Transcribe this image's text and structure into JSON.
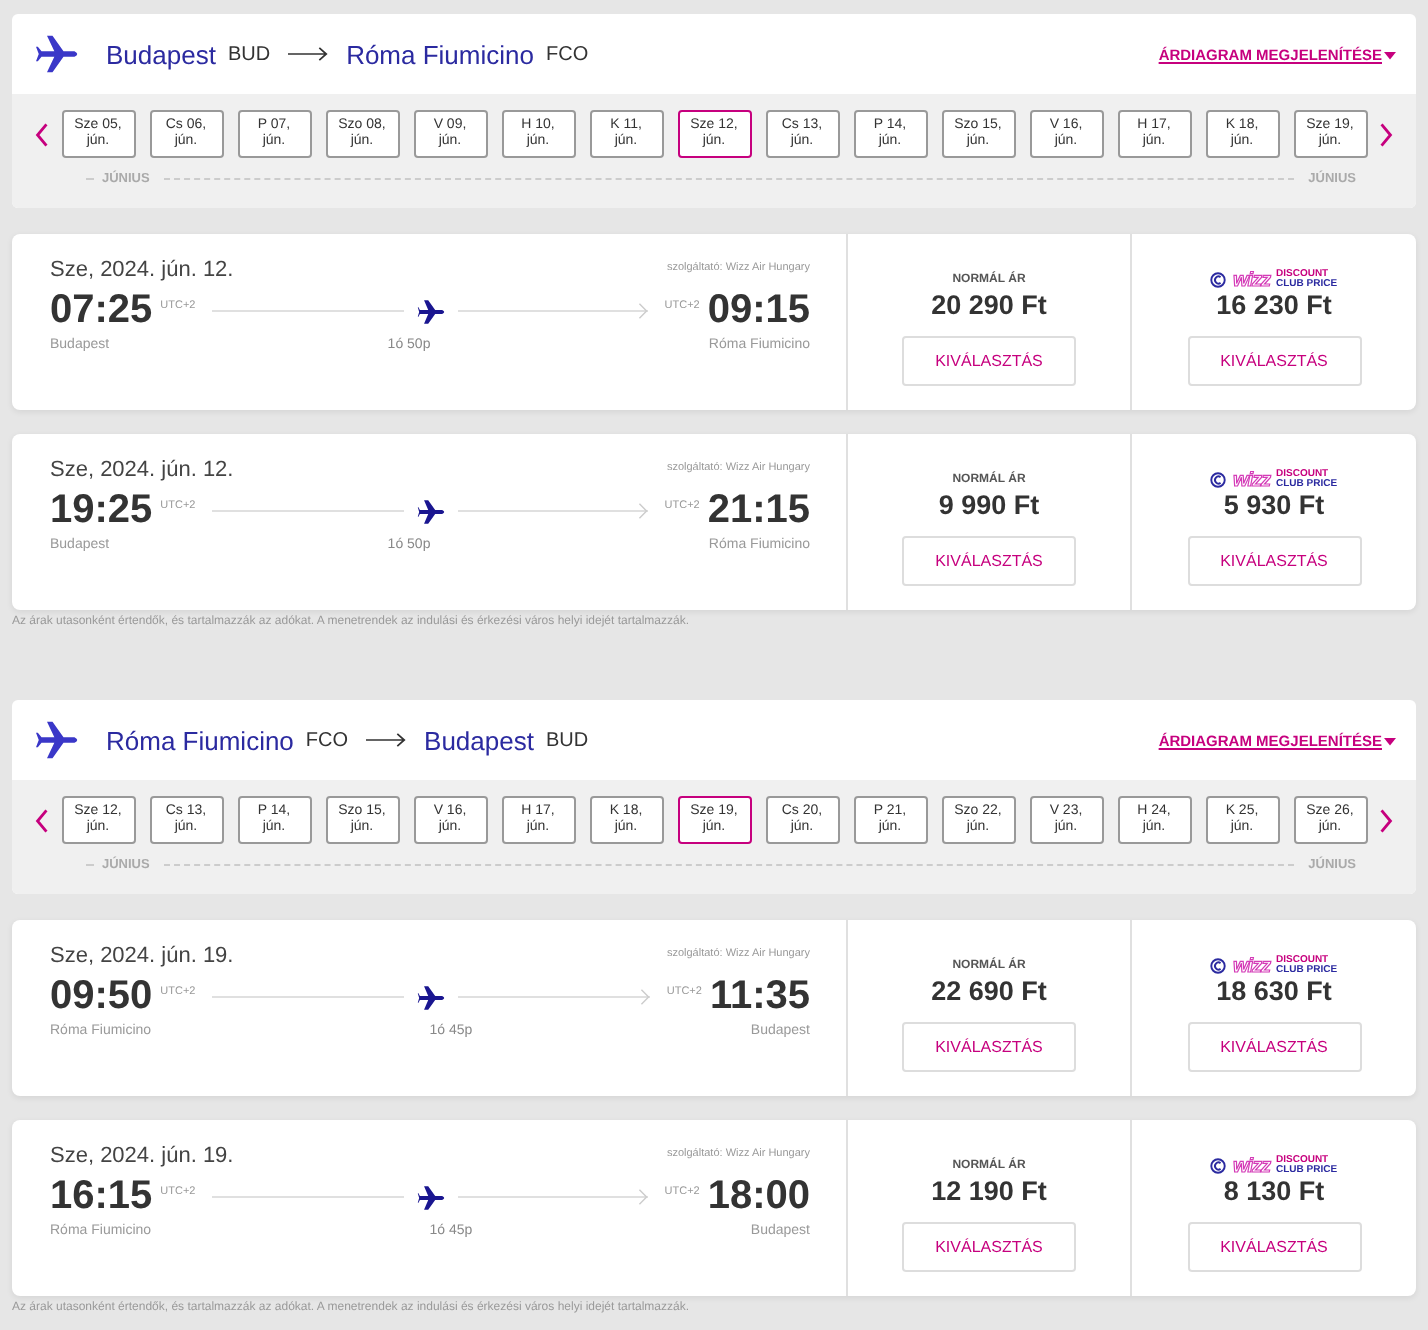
{
  "sections": [
    {
      "route": {
        "from_city": "Budapest",
        "from_code": "BUD",
        "to_city": "Róma Fiumicino",
        "to_code": "FCO"
      },
      "price_chart_link": "ÁRDIAGRAM MEGJELENÍTÉSE",
      "dates": [
        {
          "day": "Sze 05,",
          "month": "jún.",
          "selected": false
        },
        {
          "day": "Cs 06,",
          "month": "jún.",
          "selected": false
        },
        {
          "day": "P 07,",
          "month": "jún.",
          "selected": false
        },
        {
          "day": "Szo 08,",
          "month": "jún.",
          "selected": false
        },
        {
          "day": "V 09,",
          "month": "jún.",
          "selected": false
        },
        {
          "day": "H 10,",
          "month": "jún.",
          "selected": false
        },
        {
          "day": "K 11,",
          "month": "jún.",
          "selected": false
        },
        {
          "day": "Sze 12,",
          "month": "jún.",
          "selected": true
        },
        {
          "day": "Cs 13,",
          "month": "jún.",
          "selected": false
        },
        {
          "day": "P 14,",
          "month": "jún.",
          "selected": false
        },
        {
          "day": "Szo 15,",
          "month": "jún.",
          "selected": false
        },
        {
          "day": "V 16,",
          "month": "jún.",
          "selected": false
        },
        {
          "day": "H 17,",
          "month": "jún.",
          "selected": false
        },
        {
          "day": "K 18,",
          "month": "jún.",
          "selected": false
        },
        {
          "day": "Sze 19,",
          "month": "jún.",
          "selected": false
        }
      ],
      "month_labels": [
        "JÚNIUS",
        "JÚNIUS"
      ],
      "flights": [
        {
          "date": "Sze, 2024. jún. 12.",
          "operator": "szolgáltató: Wizz Air Hungary",
          "departure_time": "07:25",
          "departure_tz": "UTC+2",
          "arrival_tz": "UTC+2",
          "arrival_time": "09:15",
          "origin": "Budapest",
          "duration": "1ó 50p",
          "destination": "Róma Fiumicino",
          "normal_label": "NORMÁL ÁR",
          "normal_price": "20 290 Ft",
          "normal_button": "KIVÁLASZTÁS",
          "club_badge": {
            "brand": "wizz",
            "line1": "DISCOUNT",
            "line2": "CLUB PRICE"
          },
          "club_price": "16 230 Ft",
          "club_button": "KIVÁLASZTÁS"
        },
        {
          "date": "Sze, 2024. jún. 12.",
          "operator": "szolgáltató: Wizz Air Hungary",
          "departure_time": "19:25",
          "departure_tz": "UTC+2",
          "arrival_tz": "UTC+2",
          "arrival_time": "21:15",
          "origin": "Budapest",
          "duration": "1ó 50p",
          "destination": "Róma Fiumicino",
          "normal_label": "NORMÁL ÁR",
          "normal_price": "9 990 Ft",
          "normal_button": "KIVÁLASZTÁS",
          "club_badge": {
            "brand": "wizz",
            "line1": "DISCOUNT",
            "line2": "CLUB PRICE"
          },
          "club_price": "5 930 Ft",
          "club_button": "KIVÁLASZTÁS"
        }
      ],
      "footnote": "Az árak utasonként értendők, és tartalmazzák az adókat. A menetrendek az indulási és érkezési város helyi idejét tartalmazzák."
    },
    {
      "route": {
        "from_city": "Róma Fiumicino",
        "from_code": "FCO",
        "to_city": "Budapest",
        "to_code": "BUD"
      },
      "price_chart_link": "ÁRDIAGRAM MEGJELENÍTÉSE",
      "dates": [
        {
          "day": "Sze 12,",
          "month": "jún.",
          "selected": false
        },
        {
          "day": "Cs 13,",
          "month": "jún.",
          "selected": false
        },
        {
          "day": "P 14,",
          "month": "jún.",
          "selected": false
        },
        {
          "day": "Szo 15,",
          "month": "jún.",
          "selected": false
        },
        {
          "day": "V 16,",
          "month": "jún.",
          "selected": false
        },
        {
          "day": "H 17,",
          "month": "jún.",
          "selected": false
        },
        {
          "day": "K 18,",
          "month": "jún.",
          "selected": false
        },
        {
          "day": "Sze 19,",
          "month": "jún.",
          "selected": true
        },
        {
          "day": "Cs 20,",
          "month": "jún.",
          "selected": false
        },
        {
          "day": "P 21,",
          "month": "jún.",
          "selected": false
        },
        {
          "day": "Szo 22,",
          "month": "jún.",
          "selected": false
        },
        {
          "day": "V 23,",
          "month": "jún.",
          "selected": false
        },
        {
          "day": "H 24,",
          "month": "jún.",
          "selected": false
        },
        {
          "day": "K 25,",
          "month": "jún.",
          "selected": false
        },
        {
          "day": "Sze 26,",
          "month": "jún.",
          "selected": false
        }
      ],
      "month_labels": [
        "JÚNIUS",
        "JÚNIUS"
      ],
      "flights": [
        {
          "date": "Sze, 2024. jún. 19.",
          "operator": "szolgáltató: Wizz Air Hungary",
          "departure_time": "09:50",
          "departure_tz": "UTC+2",
          "arrival_tz": "UTC+2",
          "arrival_time": "11:35",
          "origin": "Róma Fiumicino",
          "duration": "1ó 45p",
          "destination": "Budapest",
          "normal_label": "NORMÁL ÁR",
          "normal_price": "22 690 Ft",
          "normal_button": "KIVÁLASZTÁS",
          "club_badge": {
            "brand": "wizz",
            "line1": "DISCOUNT",
            "line2": "CLUB PRICE"
          },
          "club_price": "18 630 Ft",
          "club_button": "KIVÁLASZTÁS"
        },
        {
          "date": "Sze, 2024. jún. 19.",
          "operator": "szolgáltató: Wizz Air Hungary",
          "departure_time": "16:15",
          "departure_tz": "UTC+2",
          "arrival_tz": "UTC+2",
          "arrival_time": "18:00",
          "origin": "Róma Fiumicino",
          "duration": "1ó 45p",
          "destination": "Budapest",
          "normal_label": "NORMÁL ÁR",
          "normal_price": "12 190 Ft",
          "normal_button": "KIVÁLASZTÁS",
          "club_badge": {
            "brand": "wizz",
            "line1": "DISCOUNT",
            "line2": "CLUB PRICE"
          },
          "club_price": "8 130 Ft",
          "club_button": "KIVÁLASZTÁS"
        }
      ],
      "footnote": "Az árak utasonként értendők, és tartalmazzák az adókat. A menetrendek az indulási és érkezési város helyi idejét tartalmazzák."
    }
  ]
}
